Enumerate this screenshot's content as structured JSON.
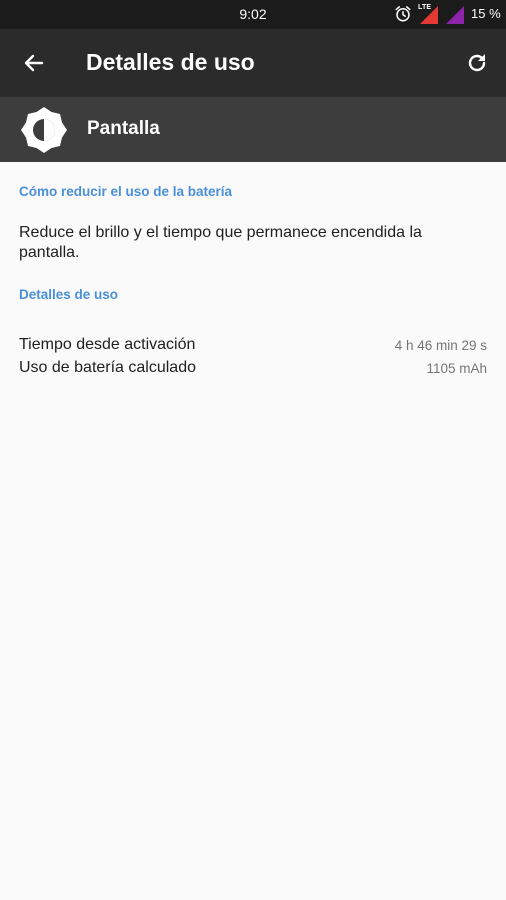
{
  "status_bar": {
    "time": "9:02",
    "network": "LTE",
    "battery": "15 %",
    "icons": [
      "alarm-icon",
      "lte-signal-icon",
      "signal-icon"
    ],
    "colors": {
      "signal_red": "#e53935",
      "signal_purple": "#8e24aa"
    }
  },
  "app_bar": {
    "title": "Detalles de uso",
    "back_icon": "arrow-back-icon",
    "refresh_icon": "refresh-icon"
  },
  "app_header": {
    "name": "Pantalla",
    "icon": "brightness-icon"
  },
  "tips": {
    "header": "Cómo reducir el uso de la batería",
    "text": "Reduce el brillo y el tiempo que permanece encendida la pantalla."
  },
  "details": {
    "header": "Detalles de uso",
    "rows": [
      {
        "label": "Tiempo desde activación",
        "value": "4 h 46 min 29 s"
      },
      {
        "label": "Uso de batería calculado",
        "value": "1105 mAh"
      }
    ]
  },
  "colors": {
    "accent": "#4a90d9",
    "app_bar_bg": "#2b2b2b",
    "header_bg": "#3d3d3d",
    "status_bg": "#1b1b1b",
    "background": "#fafafa"
  }
}
